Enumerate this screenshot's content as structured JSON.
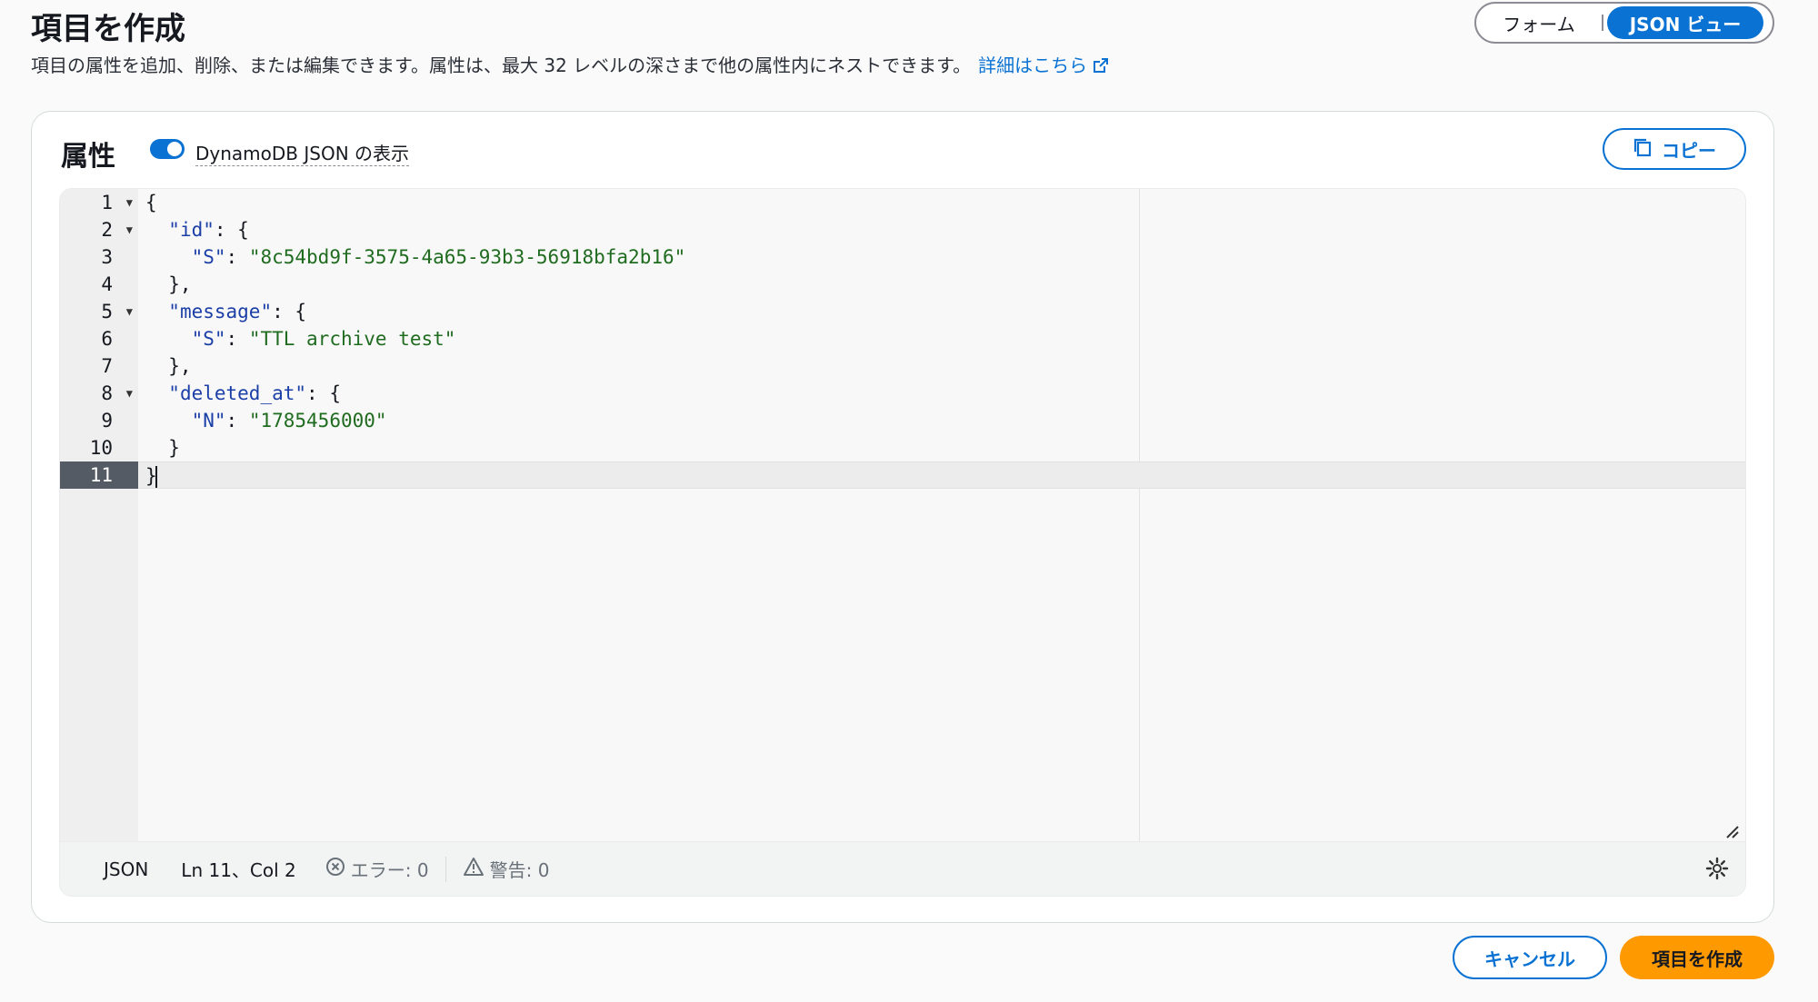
{
  "header": {
    "title": "項目を作成",
    "description": "項目の属性を追加、削除、または編集できます。属性は、最大 32 レベルの深さまで他の属性内にネストできます。",
    "learn_more": "詳細はこちら"
  },
  "view_toggle": {
    "form_label": "フォーム",
    "json_label": "JSON ビュー",
    "selected": "JSON ビュー"
  },
  "attributes": {
    "title": "属性",
    "dynamodb_json_toggle_label": "DynamoDB JSON の表示",
    "dynamodb_json_enabled": true,
    "copy_label": "コピー"
  },
  "editor": {
    "lines": [
      {
        "num": "1",
        "fold": true,
        "code": "{"
      },
      {
        "num": "2",
        "fold": true,
        "code": "  \"id\": {"
      },
      {
        "num": "3",
        "fold": false,
        "code": "    \"S\": \"8c54bd9f-3575-4a65-93b3-56918bfa2b16\""
      },
      {
        "num": "4",
        "fold": false,
        "code": "  },"
      },
      {
        "num": "5",
        "fold": true,
        "code": "  \"message\": {"
      },
      {
        "num": "6",
        "fold": false,
        "code": "    \"S\": \"TTL archive test\""
      },
      {
        "num": "7",
        "fold": false,
        "code": "  },"
      },
      {
        "num": "8",
        "fold": true,
        "code": "  \"deleted_at\": {"
      },
      {
        "num": "9",
        "fold": false,
        "code": "    \"N\": \"1785456000\""
      },
      {
        "num": "10",
        "fold": false,
        "code": "  }"
      },
      {
        "num": "11",
        "fold": false,
        "code": "}",
        "active": true
      }
    ]
  },
  "status_bar": {
    "language": "JSON",
    "position": "Ln 11、Col 2",
    "errors": "エラー: 0",
    "warnings": "警告: 0"
  },
  "footer": {
    "cancel_label": "キャンセル",
    "create_label": "項目を作成"
  },
  "colors": {
    "primary": "#0972d3",
    "create_button": "#ff9900",
    "active_line_number_bg": "#545b64"
  },
  "icons": {
    "external_link": "external-link-icon",
    "copy": "copy-icon",
    "error": "error-circle-icon",
    "warning": "warning-triangle-icon",
    "settings": "gear-icon",
    "fold": "fold-arrow-icon",
    "resize": "resize-handle-icon"
  }
}
